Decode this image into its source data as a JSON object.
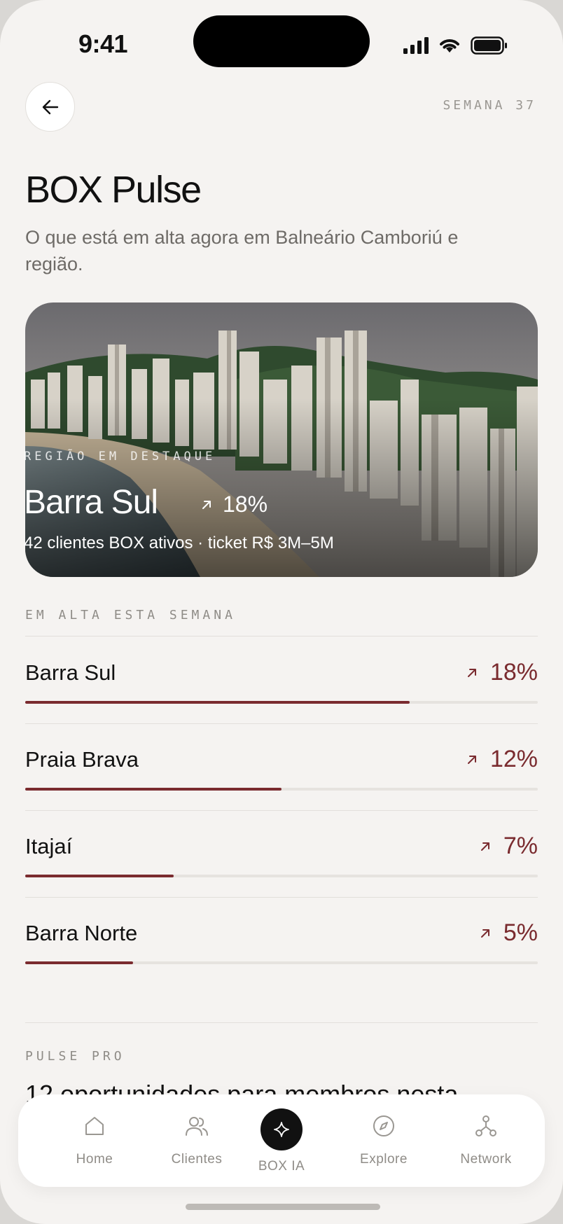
{
  "status": {
    "time": "9:41"
  },
  "header": {
    "week": "SEMANA 37"
  },
  "page": {
    "title": "BOX Pulse",
    "subtitle": "O que está em alta agora em Balneário Camboriú e região."
  },
  "hero": {
    "kicker": "REGIÃO EM DESTAQUE",
    "name": "Barra Sul",
    "delta": "18%",
    "meta": "42 clientes BOX ativos · ticket R$ 3M–5M"
  },
  "trending": {
    "label": "EM ALTA ESTA SEMANA",
    "items": [
      {
        "name": "Barra Sul",
        "delta": "18%",
        "level": 0.75
      },
      {
        "name": "Praia Brava",
        "delta": "12%",
        "level": 0.5
      },
      {
        "name": "Itajaí",
        "delta": "7%",
        "level": 0.29
      },
      {
        "name": "Barra Norte",
        "delta": "5%",
        "level": 0.21
      }
    ]
  },
  "pro": {
    "label": "PULSE PRO",
    "text": "12 oportunidades para membros nesta"
  },
  "tabbar": {
    "home": "Home",
    "clientes": "Clientes",
    "ia": "BOX IA",
    "explore": "Explore",
    "network": "Network"
  },
  "colors": {
    "accent": "#7a2b2f",
    "background": "#f5f3f1"
  }
}
